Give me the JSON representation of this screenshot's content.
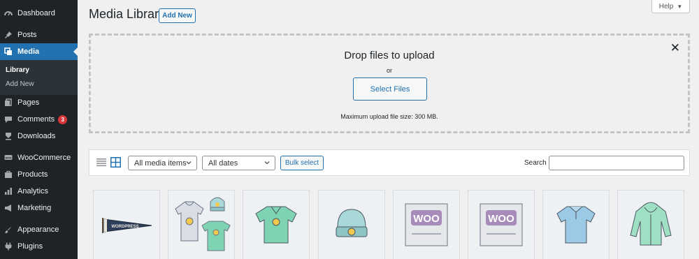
{
  "sidebar": {
    "items": [
      {
        "label": "Dashboard",
        "icon": "dashboard-icon"
      },
      {
        "label": "Posts",
        "icon": "pin-icon"
      },
      {
        "label": "Media",
        "icon": "media-icon"
      },
      {
        "label": "Pages",
        "icon": "pages-icon"
      },
      {
        "label": "Comments",
        "icon": "comment-icon",
        "badge": "3"
      },
      {
        "label": "Downloads",
        "icon": "download-icon"
      },
      {
        "label": "WooCommerce",
        "icon": "woo-icon"
      },
      {
        "label": "Products",
        "icon": "products-icon"
      },
      {
        "label": "Analytics",
        "icon": "analytics-icon"
      },
      {
        "label": "Marketing",
        "icon": "megaphone-icon"
      },
      {
        "label": "Appearance",
        "icon": "brush-icon"
      },
      {
        "label": "Plugins",
        "icon": "plugin-icon"
      }
    ],
    "submenu": [
      "Library",
      "Add New"
    ]
  },
  "header": {
    "title": "Media Library",
    "add_new_label": "Add New",
    "help_label": "Help"
  },
  "uploader": {
    "title": "Drop files to upload",
    "or": "or",
    "select_label": "Select Files",
    "max_size": "Maximum upload file size: 300 MB."
  },
  "toolbar": {
    "type_filter": "All media items",
    "date_filter": "All dates",
    "bulk_label": "Bulk select",
    "search_label": "Search",
    "search_value": ""
  },
  "media": [
    {
      "subject": "wordpress-pennant"
    },
    {
      "subject": "hoodie-beanie-tshirt"
    },
    {
      "subject": "t-shirt"
    },
    {
      "subject": "beanie"
    },
    {
      "subject": "woo-album-single"
    },
    {
      "subject": "woo-album"
    },
    {
      "subject": "polo"
    },
    {
      "subject": "hoodie"
    }
  ],
  "colors": {
    "sidebar_bg": "#1d2327",
    "accent": "#2271b1",
    "badge": "#d63638",
    "background": "#f0f0f1"
  }
}
